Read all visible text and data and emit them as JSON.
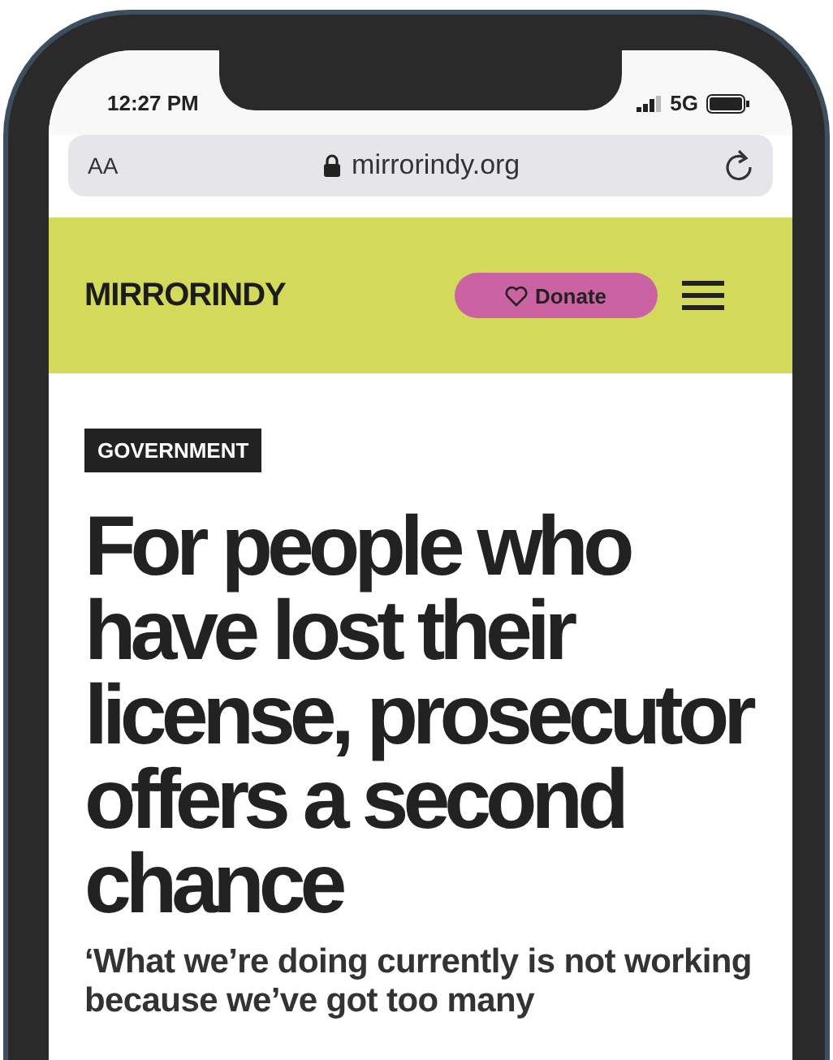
{
  "status_bar": {
    "time": "12:27 PM",
    "network": "5G"
  },
  "address_bar": {
    "text_size": "AA",
    "url": "mirrorindy.org"
  },
  "site_header": {
    "logo": "MIRROR**INDY**",
    "donate": "Donate"
  },
  "article": {
    "category": "GOVERNMENT",
    "headline": "For people who have lost their license, prosecutor offers a second chance",
    "subheadline": "‘What we’re doing currently is not working because we’ve got too many"
  }
}
